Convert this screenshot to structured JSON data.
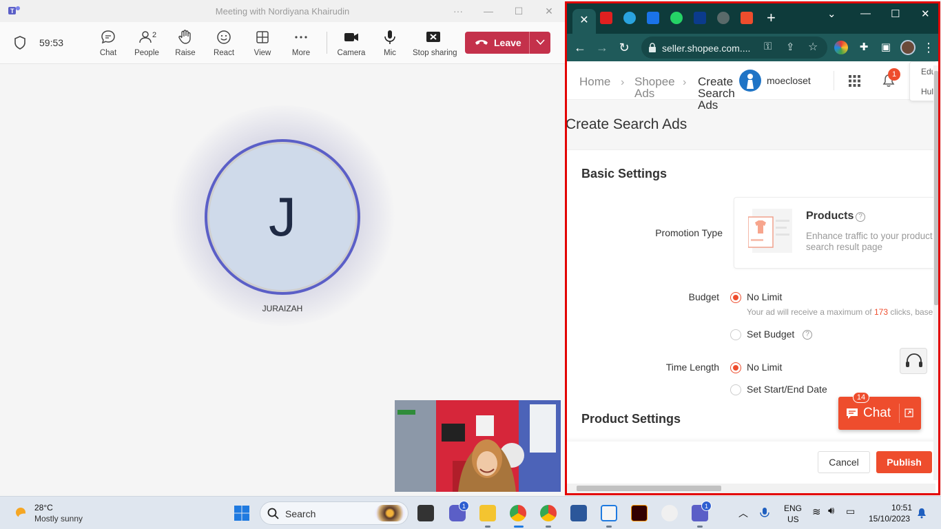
{
  "teams": {
    "window_title": "Meeting with Nordiyana Khairudin",
    "timer": "59:53",
    "toolbar": {
      "chat": "Chat",
      "people": "People",
      "people_count": "2",
      "raise": "Raise",
      "react": "React",
      "view": "View",
      "more": "More",
      "camera": "Camera",
      "mic": "Mic",
      "stop_sharing": "Stop sharing",
      "leave": "Leave"
    },
    "participant": {
      "initial": "J",
      "name": "JURAIZAH"
    },
    "accent_color": "#5b5fc7",
    "leave_color": "#c4314b"
  },
  "chrome": {
    "url": "seller.shopee.com....",
    "frame_color": "#1f5a5a",
    "highlight_border": "#e30000"
  },
  "shopee": {
    "breadcrumb": {
      "home": "Home",
      "ads_line1": "Shopee",
      "ads_line2": "Ads",
      "current_line1": "Create",
      "current_line2": "Search",
      "current_line3": "Ads"
    },
    "shop_name": "moecloset",
    "notification_count": "1",
    "side_popup": [
      "Edu",
      "Hul"
    ],
    "page_title": "Create Search Ads",
    "basic_settings": {
      "title": "Basic Settings",
      "promotion_type_label": "Promotion Type",
      "promotion_name": "Products",
      "promotion_desc_line1": "Enhance traffic to your product",
      "promotion_desc_line2": "search result page",
      "budget_label": "Budget",
      "budget_no_limit": "No Limit",
      "budget_note_prefix": "Your ad will receive a maximum of ",
      "budget_clicks": "173",
      "budget_note_suffix": " clicks, base",
      "budget_set": "Set Budget",
      "time_label": "Time Length",
      "time_no_limit": "No Limit",
      "time_set": "Set Start/End Date"
    },
    "product_settings": {
      "title": "Product Settings"
    },
    "chat": {
      "label": "Chat",
      "badge": "14"
    },
    "footer": {
      "cancel": "Cancel",
      "publish": "Publish"
    },
    "brand_color": "#ee4d2d"
  },
  "taskbar": {
    "weather_temp": "28°C",
    "weather_desc": "Mostly sunny",
    "search_label": "Search",
    "teams_badge": "1",
    "chat_badge": "1",
    "language_line1": "ENG",
    "language_line2": "US",
    "time": "10:51",
    "date": "15/10/2023"
  }
}
